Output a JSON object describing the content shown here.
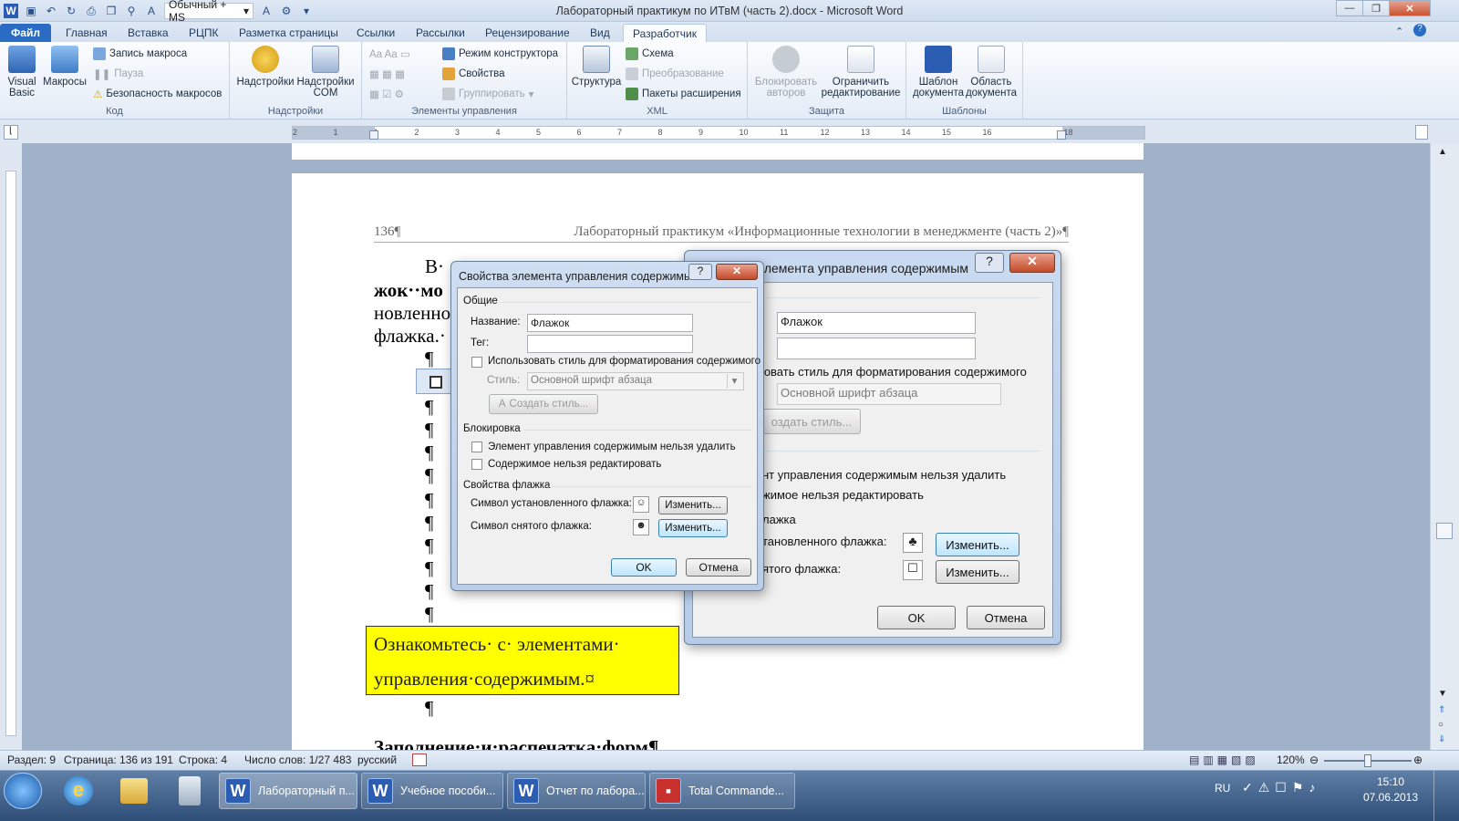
{
  "window": {
    "title": "Лабораторный практикум по ИТвМ (часть 2).docx - Microsoft Word",
    "style_box": "Обычный + MS"
  },
  "tabs": [
    {
      "label": "Файл"
    },
    {
      "label": "Главная"
    },
    {
      "label": "Вставка"
    },
    {
      "label": "РЦПК"
    },
    {
      "label": "Разметка страницы"
    },
    {
      "label": "Ссылки"
    },
    {
      "label": "Рассылки"
    },
    {
      "label": "Рецензирование"
    },
    {
      "label": "Вид"
    },
    {
      "label": "Разработчик"
    }
  ],
  "ribbon": {
    "code": {
      "label": "Код",
      "visual_basic": "Visual Basic",
      "macros": "Макросы",
      "record": "Запись макроса",
      "pause": "Пауза",
      "security": "Безопасность макросов"
    },
    "addins": {
      "label": "Надстройки",
      "addins": "Надстройки",
      "com": "Надстройки COM"
    },
    "controls": {
      "label": "Элементы управления",
      "design_mode": "Режим конструктора",
      "properties": "Свойства",
      "group": "Группировать"
    },
    "xml": {
      "label": "XML",
      "structure": "Структура",
      "schema": "Схема",
      "transform": "Преобразование",
      "packs": "Пакеты расширения"
    },
    "protect": {
      "label": "Защита",
      "block_authors": "Блокировать авторов",
      "restrict": "Ограничить редактирование"
    },
    "templates": {
      "label": "Шаблоны",
      "doc_template": "Шаблон документа",
      "doc_panel": "Область документа"
    }
  },
  "ruler": {
    "numbers": [
      "2",
      "1",
      "1",
      "2",
      "3",
      "4",
      "5",
      "6",
      "7",
      "8",
      "9",
      "10",
      "11",
      "12",
      "13",
      "14",
      "15",
      "16",
      "18"
    ]
  },
  "document": {
    "page_number": "136¶",
    "running_header": "Лабораторный практикум «Информационные технологии в менеджменте (часть 2)»¶",
    "line1": "В·",
    "line2": "жок··мо",
    "line3": "новленно",
    "line4": "флажка.·",
    "pilcrow": "¶",
    "box_line1": "Ознакомьтесь· с· элементами·",
    "box_line2": "управления·содержимым.¤",
    "heading": "Заполнение·и·распечатка·форм¶"
  },
  "dialog_back": {
    "title": "элемента управления содержимым",
    "name_value": "Флажок",
    "use_style": "зовать стиль для форматирования содержимого",
    "style_value": "Основной шрифт абзаца",
    "create_style": "оздать стиль...",
    "lock1": "нт управления содержимым нельзя удалить",
    "lock2": "жимое нельзя редактировать",
    "checkbox_section": "лажка",
    "checked_symbol": "тановленного флажка:",
    "unchecked_symbol": "ятого флажка:",
    "change": "Изменить...",
    "ok": "OK",
    "cancel": "Отмена"
  },
  "dialog_front": {
    "title": "Свойства элемента управления содержимым",
    "general": "Общие",
    "name_label": "Название:",
    "name_value": "Флажок",
    "tag_label": "Тег:",
    "tag_value": "",
    "use_style": "Использовать стиль для форматирования содержимого",
    "style_label": "Стиль:",
    "style_value": "Основной шрифт абзаца",
    "create_style": "Создать стиль...",
    "locking": "Блокировка",
    "lock_delete": "Элемент управления содержимым нельзя удалить",
    "lock_edit": "Содержимое нельзя редактировать",
    "checkbox_props": "Свойства флажка",
    "checked_symbol": "Символ установленного флажка:",
    "unchecked_symbol": "Символ снятого флажка:",
    "change": "Изменить...",
    "ok": "OK",
    "cancel": "Отмена"
  },
  "status": {
    "section": "Раздел: 9",
    "page": "Страница: 136 из 191",
    "line": "Строка: 4",
    "words": "Число слов: 1/27 483",
    "lang": "русский",
    "zoom": "120%"
  },
  "taskbar": {
    "items": [
      {
        "label": "Лабораторный п..."
      },
      {
        "label": "Учебное пособи..."
      },
      {
        "label": "Отчет по лабора..."
      },
      {
        "label": "Total Commande..."
      }
    ],
    "lang": "RU",
    "time": "15:10",
    "date": "07.06.2013"
  }
}
